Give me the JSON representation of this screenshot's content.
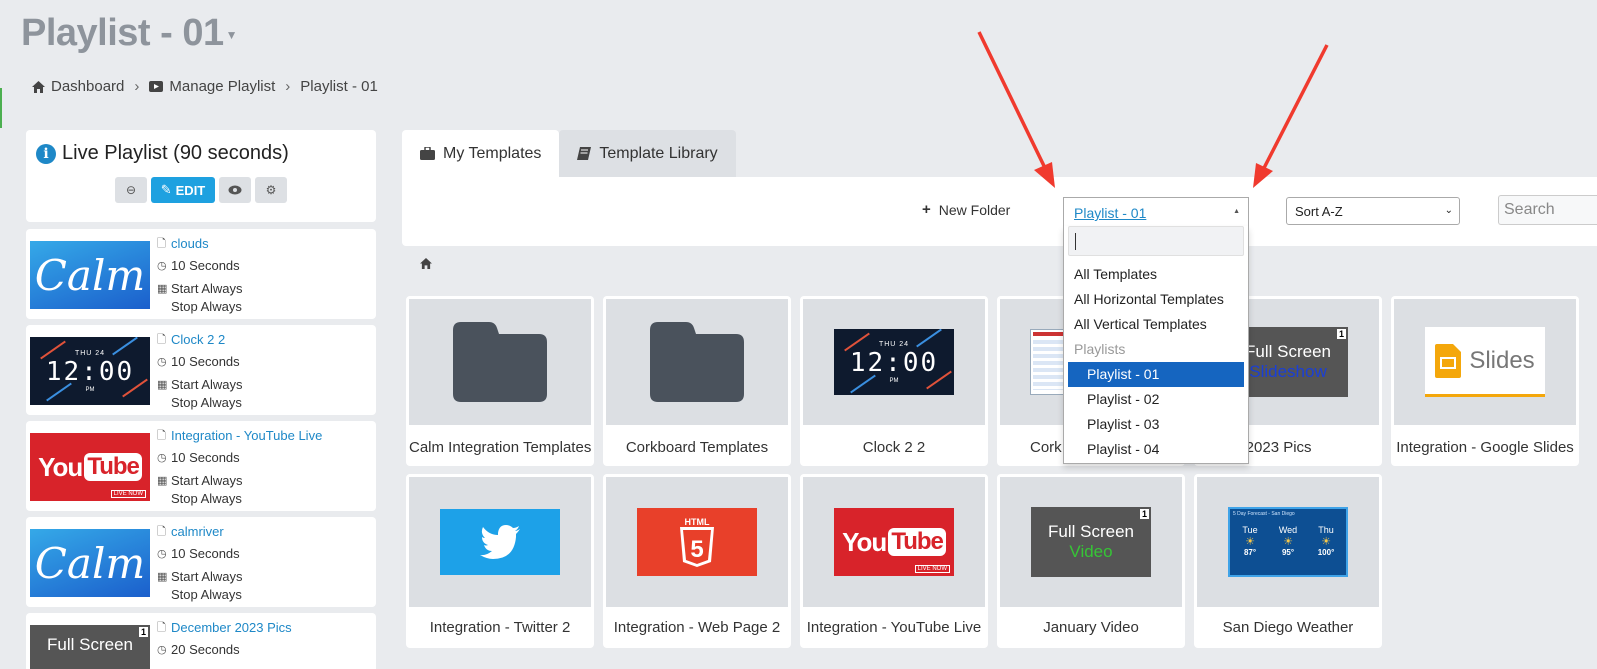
{
  "header": {
    "title": "Playlist - 01"
  },
  "breadcrumb": [
    {
      "label": "Dashboard",
      "icon": "home-icon"
    },
    {
      "label": "Manage Playlist",
      "icon": "video-icon"
    },
    {
      "label": "Playlist - 01"
    }
  ],
  "live_playlist": {
    "title": "Live Playlist (90 seconds)",
    "edit_label": "EDIT"
  },
  "playlist_items": [
    {
      "name": "clouds",
      "duration": "10 Seconds",
      "start": "Start Always",
      "stop": "Stop Always",
      "thumb": "calm"
    },
    {
      "name": "Clock 2 2",
      "duration": "10 Seconds",
      "start": "Start Always",
      "stop": "Stop Always",
      "thumb": "clock"
    },
    {
      "name": "Integration - YouTube Live",
      "duration": "10 Seconds",
      "start": "Start Always",
      "stop": "Stop Always",
      "thumb": "youtube"
    },
    {
      "name": "calmriver",
      "duration": "10 Seconds",
      "start": "Start Always",
      "stop": "Stop Always",
      "thumb": "calm"
    },
    {
      "name": "December 2023 Pics",
      "duration": "20 Seconds",
      "thumb": "fullscreen"
    }
  ],
  "thumbs": {
    "calm_text": "Calm",
    "clock_day": "THU 24",
    "clock_time": "12:00",
    "clock_pm": "PM",
    "yt_you": "You",
    "yt_tube": "Tube",
    "yt_live": "LIVE NOW",
    "fs_line1": "Full Screen",
    "fs_slideshow": "Slideshow",
    "fs_video": "Video",
    "fs_badge": "1",
    "html_text": "HTML",
    "slides_text": "Slides"
  },
  "tabs": [
    {
      "label": "My Templates",
      "active": true
    },
    {
      "label": "Template Library",
      "active": false
    }
  ],
  "toolbar": {
    "new_folder": "New Folder",
    "playlist_selected": "Playlist - 01",
    "sort_selected": "Sort A-Z",
    "search_placeholder": "Search"
  },
  "dropdown": {
    "options": [
      "All Templates",
      "All Horizontal Templates",
      "All Vertical Templates"
    ],
    "group_label": "Playlists",
    "playlists": [
      "Playlist - 01",
      "Playlist - 02",
      "Playlist - 03",
      "Playlist - 04"
    ],
    "selected": "Playlist - 01"
  },
  "templates_row1": [
    {
      "label": "Calm Integration Templates",
      "type": "folder"
    },
    {
      "label": "Corkboard Templates",
      "type": "folder"
    },
    {
      "label": "Clock 2 2",
      "type": "clock"
    },
    {
      "label": "Cork",
      "type": "corkboard"
    },
    {
      "label": "ember 2023 Pics",
      "type": "slideshow"
    },
    {
      "label": "Integration - Google Slides",
      "type": "slides"
    }
  ],
  "templates_row2": [
    {
      "label": "Integration - Twitter 2",
      "type": "twitter"
    },
    {
      "label": "Integration - Web Page 2",
      "type": "html5"
    },
    {
      "label": "Integration - YouTube Live",
      "type": "youtube"
    },
    {
      "label": "January Video",
      "type": "video"
    },
    {
      "label": "San Diego Weather",
      "type": "weather"
    }
  ],
  "weather": {
    "title": "5 Day Forecast - San Diego",
    "days": [
      {
        "day": "Tue",
        "hi": "87°"
      },
      {
        "day": "Wed",
        "hi": "95°"
      },
      {
        "day": "Thu",
        "hi": "100°"
      }
    ]
  },
  "colors": {
    "accent": "#1ea1e0",
    "link": "#1e88c7",
    "selected": "#1565c0",
    "annotation_arrow": "#f03a2e"
  }
}
